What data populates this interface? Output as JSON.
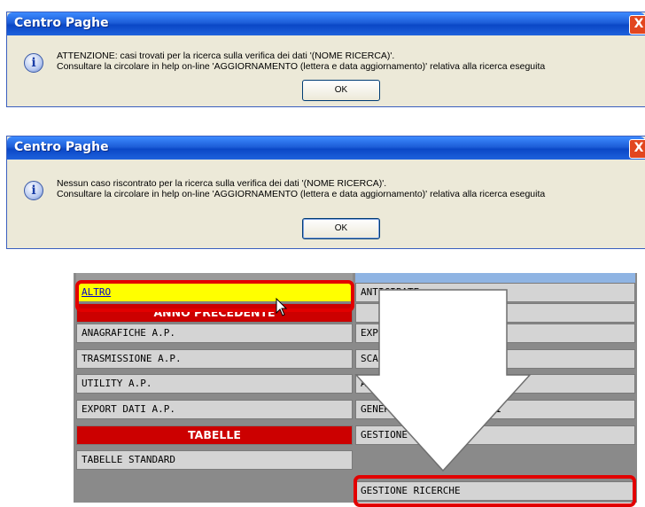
{
  "dialog1": {
    "title": "Centro Paghe",
    "close_label": "X",
    "line1": "ATTENZIONE: casi trovati per la ricerca sulla verifica dei dati '(NOME RICERCA)'.",
    "line2": "Consultare la circolare in help on-line 'AGGIORNAMENTO (lettera e data aggiornamento)' relativa alla ricerca eseguita",
    "ok_label": "OK"
  },
  "dialog2": {
    "title": "Centro Paghe",
    "close_label": "X",
    "line1": "Nessun caso riscontrato per la ricerca sulla verifica dei dati '(NOME RICERCA)'.",
    "line2": "Consultare la circolare in help on-line 'AGGIORNAMENTO (lettera e data aggiornamento)' relativa alla ricerca eseguita",
    "ok_label": "OK"
  },
  "menu": {
    "left": [
      "ALTRO",
      "ANNO PRECEDENTE",
      "ANAGRAFICHE A.P.",
      "TRASMISSIONE A.P.",
      "UTILITY A.P.",
      "EXPORT DATI A.P.",
      "TABELLE",
      "TABELLE STANDARD"
    ],
    "right": [
      "ANTICIPATE",
      "",
      "EXPORT DATI",
      "SCARICO TRACC          ATI VARI",
      "ARCHIVIO MESI          ATI",
      "GENERAZIONE R          ARAMETRICI",
      "GESTIONE PDF",
      "GESTIONE RICERCHE"
    ]
  },
  "colors": {
    "header_red": "#cc0000",
    "highlight_yellow": "#ffff00",
    "frame_red": "#e20000",
    "xp_title_blue": "#0a47c6"
  }
}
